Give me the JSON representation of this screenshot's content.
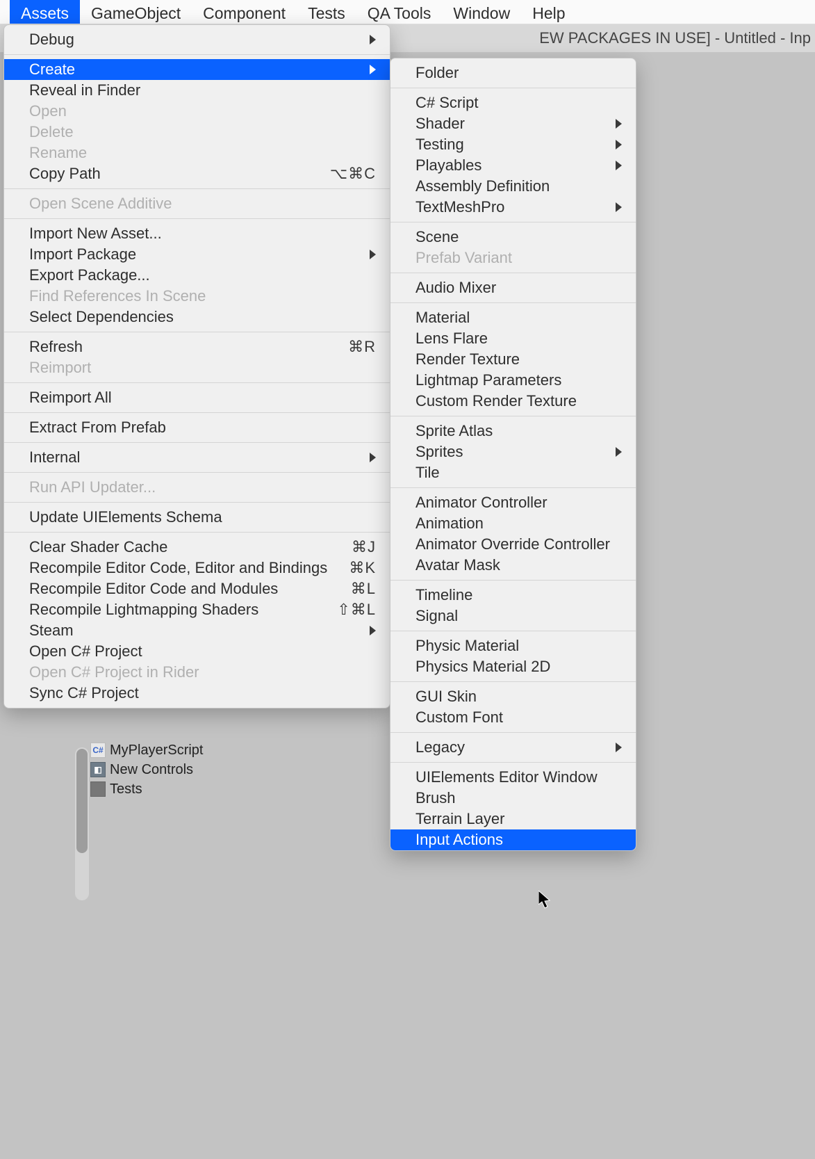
{
  "menubar": {
    "items": [
      "Assets",
      "GameObject",
      "Component",
      "Tests",
      "QA Tools",
      "Window",
      "Help"
    ],
    "active_index": 0
  },
  "title_strip": "EW PACKAGES IN USE] - Untitled - Inp",
  "assets_menu": {
    "groups": [
      [
        {
          "label": "Debug",
          "submenu": true
        }
      ],
      [
        {
          "label": "Create",
          "submenu": true,
          "highlight": true
        },
        {
          "label": "Reveal in Finder"
        },
        {
          "label": "Open",
          "disabled": true
        },
        {
          "label": "Delete",
          "disabled": true
        },
        {
          "label": "Rename",
          "disabled": true
        },
        {
          "label": "Copy Path",
          "shortcut": "⌥⌘C"
        }
      ],
      [
        {
          "label": "Open Scene Additive",
          "disabled": true
        }
      ],
      [
        {
          "label": "Import New Asset..."
        },
        {
          "label": "Import Package",
          "submenu": true
        },
        {
          "label": "Export Package..."
        },
        {
          "label": "Find References In Scene",
          "disabled": true
        },
        {
          "label": "Select Dependencies"
        }
      ],
      [
        {
          "label": "Refresh",
          "shortcut": "⌘R"
        },
        {
          "label": "Reimport",
          "disabled": true
        }
      ],
      [
        {
          "label": "Reimport All"
        }
      ],
      [
        {
          "label": "Extract From Prefab"
        }
      ],
      [
        {
          "label": "Internal",
          "submenu": true
        }
      ],
      [
        {
          "label": "Run API Updater...",
          "disabled": true
        }
      ],
      [
        {
          "label": "Update UIElements Schema"
        }
      ],
      [
        {
          "label": "Clear Shader Cache",
          "shortcut": "⌘J"
        },
        {
          "label": "Recompile Editor Code, Editor and Bindings",
          "shortcut": "⌘K"
        },
        {
          "label": "Recompile Editor Code and Modules",
          "shortcut": "⌘L"
        },
        {
          "label": "Recompile Lightmapping Shaders",
          "shortcut": "⇧⌘L"
        },
        {
          "label": "Steam",
          "submenu": true
        },
        {
          "label": "Open C# Project"
        },
        {
          "label": "Open C# Project in Rider",
          "disabled": true
        },
        {
          "label": "Sync C# Project"
        }
      ]
    ]
  },
  "create_menu": {
    "groups": [
      [
        {
          "label": "Folder"
        }
      ],
      [
        {
          "label": "C# Script"
        },
        {
          "label": "Shader",
          "submenu": true
        },
        {
          "label": "Testing",
          "submenu": true
        },
        {
          "label": "Playables",
          "submenu": true
        },
        {
          "label": "Assembly Definition"
        },
        {
          "label": "TextMeshPro",
          "submenu": true
        }
      ],
      [
        {
          "label": "Scene"
        },
        {
          "label": "Prefab Variant",
          "disabled": true
        }
      ],
      [
        {
          "label": "Audio Mixer"
        }
      ],
      [
        {
          "label": "Material"
        },
        {
          "label": "Lens Flare"
        },
        {
          "label": "Render Texture"
        },
        {
          "label": "Lightmap Parameters"
        },
        {
          "label": "Custom Render Texture"
        }
      ],
      [
        {
          "label": "Sprite Atlas"
        },
        {
          "label": "Sprites",
          "submenu": true
        },
        {
          "label": "Tile"
        }
      ],
      [
        {
          "label": "Animator Controller"
        },
        {
          "label": "Animation"
        },
        {
          "label": "Animator Override Controller"
        },
        {
          "label": "Avatar Mask"
        }
      ],
      [
        {
          "label": "Timeline"
        },
        {
          "label": "Signal"
        }
      ],
      [
        {
          "label": "Physic Material"
        },
        {
          "label": "Physics Material 2D"
        }
      ],
      [
        {
          "label": "GUI Skin"
        },
        {
          "label": "Custom Font"
        }
      ],
      [
        {
          "label": "Legacy",
          "submenu": true
        }
      ],
      [
        {
          "label": "UIElements Editor Window"
        },
        {
          "label": "Brush"
        },
        {
          "label": "Terrain Layer"
        },
        {
          "label": "Input Actions",
          "highlight": true
        }
      ]
    ]
  },
  "project_rows": [
    {
      "icon": "cs",
      "label": "MyPlayerScript"
    },
    {
      "icon": "asset",
      "label": "New Controls"
    },
    {
      "icon": "folder",
      "label": "Tests"
    }
  ]
}
